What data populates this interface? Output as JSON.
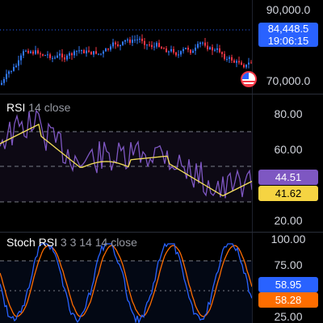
{
  "price_pane": {
    "axis_labels": [
      "90,000.0",
      "70,000.0"
    ],
    "last_price": "84,448.5",
    "countdown": "19:06:15",
    "colors": {
      "up": "#3179f5",
      "down": "#f23645",
      "tag_bg": "#2962ff",
      "dotted_line": "#2962ff"
    }
  },
  "rsi_pane": {
    "title": "RSI",
    "params": "14 close",
    "axis_labels": [
      "80.00",
      "60.00",
      "20.00"
    ],
    "rsi_value": "44.51",
    "ma_value": "41.62",
    "colors": {
      "rsi": "#7e57c2",
      "ma": "#f5e05a",
      "rsi_tag": "#7e57c2",
      "ma_tag": "#f5d442"
    }
  },
  "stoch_pane": {
    "title": "Stoch RSI",
    "params": "3 3 14 14 close",
    "axis_labels": [
      "100.00",
      "75.00",
      "25.00"
    ],
    "k_value": "58.95",
    "d_value": "58.28",
    "colors": {
      "k": "#2962ff",
      "d": "#ff6d00",
      "k_tag": "#2962ff",
      "d_tag": "#ff6d00"
    }
  }
}
